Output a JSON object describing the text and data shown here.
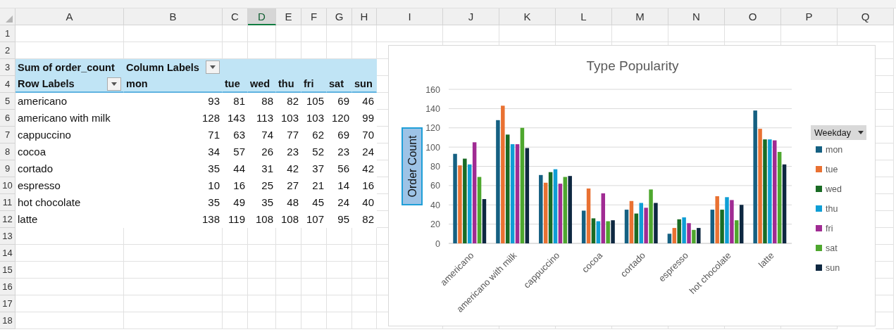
{
  "sheet": {
    "columns": [
      {
        "label": "A",
        "selected": false
      },
      {
        "label": "B",
        "selected": false
      },
      {
        "label": "C",
        "selected": false
      },
      {
        "label": "D",
        "selected": true
      },
      {
        "label": "E",
        "selected": false
      },
      {
        "label": "F",
        "selected": false
      },
      {
        "label": "G",
        "selected": false
      },
      {
        "label": "H",
        "selected": false
      },
      {
        "label": "I",
        "selected": false
      },
      {
        "label": "J",
        "selected": false
      },
      {
        "label": "K",
        "selected": false
      },
      {
        "label": "L",
        "selected": false
      },
      {
        "label": "M",
        "selected": false
      },
      {
        "label": "N",
        "selected": false
      },
      {
        "label": "O",
        "selected": false
      },
      {
        "label": "P",
        "selected": false
      },
      {
        "label": "Q",
        "selected": false
      }
    ],
    "rows": [
      "1",
      "2",
      "3",
      "4",
      "5",
      "6",
      "7",
      "8",
      "9",
      "10",
      "11",
      "12",
      "13",
      "14",
      "15",
      "16",
      "17",
      "18"
    ]
  },
  "pivot": {
    "value_field": "Sum of order_count",
    "column_labels": "Column Labels",
    "row_labels": "Row Labels",
    "columns": [
      "mon",
      "tue",
      "wed",
      "thu",
      "fri",
      "sat",
      "sun"
    ],
    "rows": [
      {
        "label": "americano",
        "values": [
          "93",
          "81",
          "88",
          "82",
          "105",
          "69",
          "46"
        ]
      },
      {
        "label": "americano with milk",
        "values": [
          "128",
          "143",
          "113",
          "103",
          "103",
          "120",
          "99"
        ]
      },
      {
        "label": "cappuccino",
        "values": [
          "71",
          "63",
          "74",
          "77",
          "62",
          "69",
          "70"
        ]
      },
      {
        "label": "cocoa",
        "values": [
          "34",
          "57",
          "26",
          "23",
          "52",
          "23",
          "24"
        ]
      },
      {
        "label": "cortado",
        "values": [
          "35",
          "44",
          "31",
          "42",
          "37",
          "56",
          "42"
        ]
      },
      {
        "label": "espresso",
        "values": [
          "10",
          "16",
          "25",
          "27",
          "21",
          "14",
          "16"
        ]
      },
      {
        "label": "hot chocolate",
        "values": [
          "35",
          "49",
          "35",
          "48",
          "45",
          "24",
          "40"
        ]
      },
      {
        "label": "latte",
        "values": [
          "138",
          "119",
          "108",
          "108",
          "107",
          "95",
          "82"
        ]
      }
    ]
  },
  "chart": {
    "legend_title": "Weekday",
    "chart_data": {
      "type": "bar",
      "grid": true,
      "legend": "right",
      "title": "Type Popularity",
      "ylabel": "Order Count",
      "categories": [
        "americano",
        "americano with milk",
        "cappuccino",
        "cocoa",
        "cortado",
        "espresso",
        "hot chocolate",
        "latte"
      ],
      "ylim": [
        0,
        160
      ],
      "yticks": [
        0,
        20,
        40,
        60,
        80,
        100,
        120,
        140,
        160
      ],
      "series": [
        {
          "name": "mon",
          "color": "#156082",
          "values": [
            93,
            128,
            71,
            34,
            35,
            10,
            35,
            138
          ]
        },
        {
          "name": "tue",
          "color": "#e97132",
          "values": [
            81,
            143,
            63,
            57,
            44,
            16,
            49,
            119
          ]
        },
        {
          "name": "wed",
          "color": "#196b24",
          "values": [
            88,
            113,
            74,
            26,
            31,
            25,
            35,
            108
          ]
        },
        {
          "name": "thu",
          "color": "#0f9ed5",
          "values": [
            82,
            103,
            77,
            23,
            42,
            27,
            48,
            108
          ]
        },
        {
          "name": "fri",
          "color": "#a02b93",
          "values": [
            105,
            103,
            62,
            52,
            37,
            21,
            45,
            107
          ]
        },
        {
          "name": "sat",
          "color": "#4ea72e",
          "values": [
            69,
            120,
            69,
            23,
            56,
            14,
            24,
            95
          ]
        },
        {
          "name": "sun",
          "color": "#0e2841",
          "values": [
            46,
            99,
            70,
            24,
            42,
            16,
            40,
            82
          ]
        }
      ]
    }
  }
}
